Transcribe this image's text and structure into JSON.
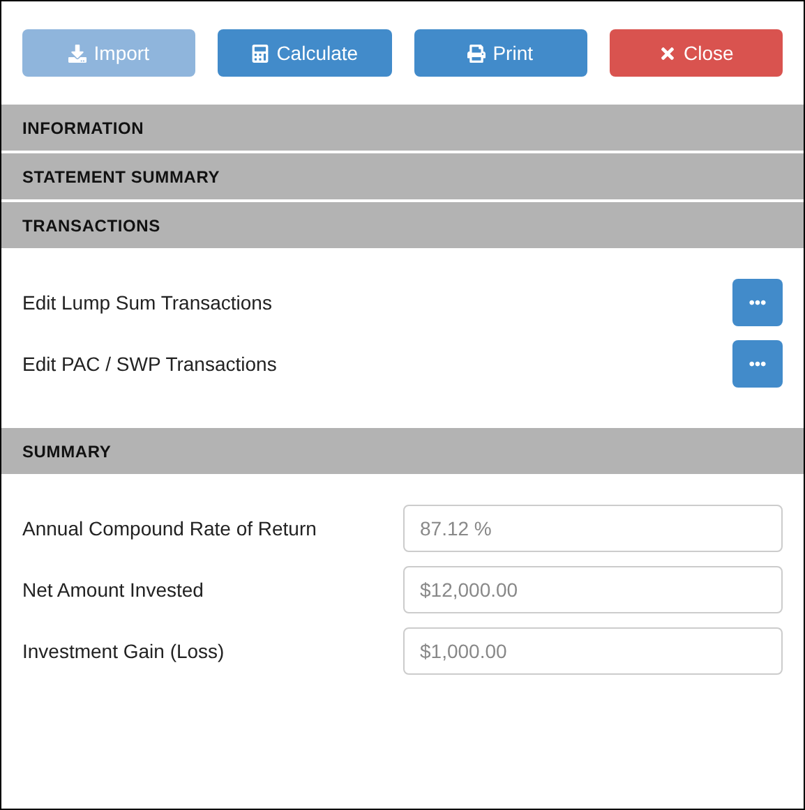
{
  "toolbar": [
    {
      "label": "Import",
      "kind": "primary",
      "disabled": true
    },
    {
      "label": "Calculate",
      "kind": "primary",
      "disabled": false
    },
    {
      "label": "Print",
      "kind": "primary",
      "disabled": false
    },
    {
      "label": "Close",
      "kind": "danger",
      "disabled": false
    }
  ],
  "sections": [
    {
      "title": "INFORMATION"
    },
    {
      "title": "STATEMENT SUMMARY"
    },
    {
      "title": "TRANSACTIONS",
      "kind": "actions",
      "items": [
        {
          "label": "Edit Lump Sum Transactions"
        },
        {
          "label": "Edit PAC / SWP Transactions"
        }
      ]
    },
    {
      "title": "SUMMARY",
      "kind": "fields",
      "items": [
        {
          "label": "Annual Compound Rate of Return",
          "value": "87.12 %"
        },
        {
          "label": "Net Amount Invested",
          "value": "$12,000.00"
        },
        {
          "label": "Investment Gain (Loss)",
          "value": "$1,000.00"
        }
      ]
    }
  ]
}
